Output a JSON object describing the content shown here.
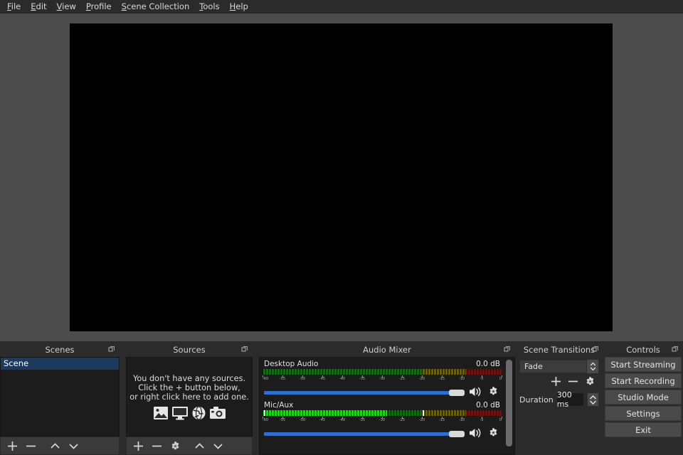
{
  "app": {
    "title": "OBS Studio"
  },
  "menubar": {
    "items": [
      {
        "label": "File",
        "mnemonic": "F"
      },
      {
        "label": "Edit",
        "mnemonic": "E"
      },
      {
        "label": "View",
        "mnemonic": "V"
      },
      {
        "label": "Profile",
        "mnemonic": "P"
      },
      {
        "label": "Scene Collection",
        "mnemonic": "S"
      },
      {
        "label": "Tools",
        "mnemonic": "T"
      },
      {
        "label": "Help",
        "mnemonic": "H"
      }
    ]
  },
  "preview": {
    "canvas_color": "#000000",
    "background_color": "#4c4c4c"
  },
  "scenes": {
    "title": "Scenes",
    "items": [
      {
        "name": "Scene",
        "selected": true
      }
    ],
    "toolbar": [
      {
        "icon": "plus-icon",
        "label": "Add Scene"
      },
      {
        "icon": "minus-icon",
        "label": "Remove Scene"
      },
      {
        "icon": "chevron-up-icon",
        "label": "Move Scene Up"
      },
      {
        "icon": "chevron-down-icon",
        "label": "Move Scene Down"
      }
    ]
  },
  "sources": {
    "title": "Sources",
    "empty_message_lines": [
      "You don't have any sources.",
      "Click the + button below,",
      "or right click here to add one."
    ],
    "empty_icons": [
      "image-icon",
      "monitor-icon",
      "globe-icon",
      "camera-icon"
    ],
    "toolbar": [
      {
        "icon": "plus-icon",
        "label": "Add Source"
      },
      {
        "icon": "minus-icon",
        "label": "Remove Source"
      },
      {
        "icon": "gear-icon",
        "label": "Source Properties"
      },
      {
        "icon": "chevron-up-icon",
        "label": "Move Source Up"
      },
      {
        "icon": "chevron-down-icon",
        "label": "Move Source Down"
      }
    ]
  },
  "audio_mixer": {
    "title": "Audio Mixer",
    "scale_labels": [
      "-60",
      "-55",
      "-50",
      "-45",
      "-40",
      "-35",
      "-30",
      "-25",
      "-20",
      "-15",
      "-10",
      "-5",
      "0"
    ],
    "scale_min_db": -60,
    "scale_max_db": 0,
    "channels": [
      {
        "name": "Desktop Audio",
        "db": "0.0 dB",
        "active": false,
        "level_pct": 0,
        "peak_pct": 0,
        "volume_pct": 100,
        "muted": false,
        "speaker_icon": "speaker-on-icon",
        "gear_icon": "gear-icon"
      },
      {
        "name": "Mic/Aux",
        "db": "0.0 dB",
        "active": true,
        "level_pct": 52,
        "peak_pct": 67,
        "volume_pct": 100,
        "muted": false,
        "speaker_icon": "speaker-on-icon",
        "gear_icon": "gear-icon"
      }
    ],
    "meter_colors": {
      "green": "#1fd01f",
      "yellow": "#d5c31f",
      "red": "#cc2020",
      "green_dim": "#176b17",
      "yellow_dim": "#6b6116",
      "red_dim": "#6b1313"
    }
  },
  "scene_transitions": {
    "title": "Scene Transitions",
    "selected_transition": "Fade",
    "buttons": [
      {
        "icon": "plus-icon",
        "label": "Add Transition"
      },
      {
        "icon": "minus-icon",
        "label": "Remove Transition"
      },
      {
        "icon": "gear-icon",
        "label": "Transition Properties"
      }
    ],
    "duration_label": "Duration",
    "duration_value": "300 ms"
  },
  "controls": {
    "title": "Controls",
    "buttons": [
      {
        "label": "Start Streaming"
      },
      {
        "label": "Start Recording"
      },
      {
        "label": "Studio Mode"
      },
      {
        "label": "Settings"
      },
      {
        "label": "Exit"
      }
    ]
  },
  "colors": {
    "accent_blue": "#2f6fd0",
    "selection_blue": "#1d3a5e",
    "panel_bg": "#2b2b2b",
    "list_bg": "#1c1c1c",
    "button_bg": "#4a4a4a"
  }
}
